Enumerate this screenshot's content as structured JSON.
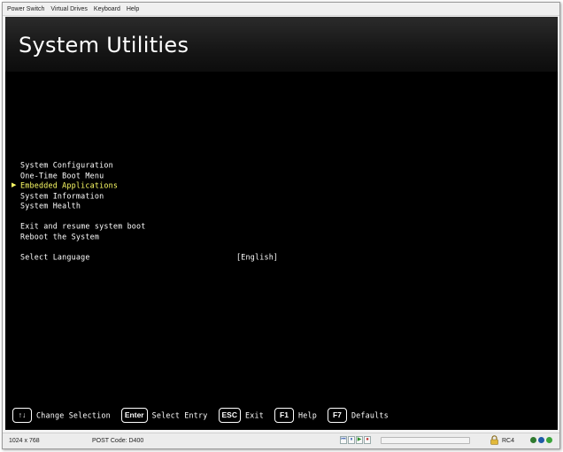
{
  "menubar": {
    "items": [
      "Power Switch",
      "Virtual Drives",
      "Keyboard",
      "Help"
    ]
  },
  "banner": {
    "title": "System Utilities"
  },
  "menu": {
    "items": [
      "System Configuration",
      "One-Time Boot Menu",
      "Embedded Applications",
      "System Information",
      "System Health",
      "Exit and resume system boot",
      "Reboot the System",
      "Select Language"
    ],
    "selected": "Embedded Applications",
    "language_value": "[English]"
  },
  "footer": {
    "keys": [
      {
        "key": "↑↓",
        "label": "Change Selection"
      },
      {
        "key": "Enter",
        "label": "Select Entry"
      },
      {
        "key": "ESC",
        "label": "Exit"
      },
      {
        "key": "F1",
        "label": "Help"
      },
      {
        "key": "F7",
        "label": "Defaults"
      }
    ]
  },
  "statusbar": {
    "resolution": "1024 x 768",
    "post_code": "POST Code: D400",
    "media_icons": [
      "skip-back-icon",
      "pause-icon",
      "play-icon",
      "record-icon"
    ],
    "label": "RC4",
    "status_colors": [
      "#2f7a2f",
      "#1f5aa8",
      "#3aa53a"
    ]
  },
  "colors": {
    "screen_bg": "#000000",
    "text": "#ffffff",
    "selected": "#ffff66"
  }
}
